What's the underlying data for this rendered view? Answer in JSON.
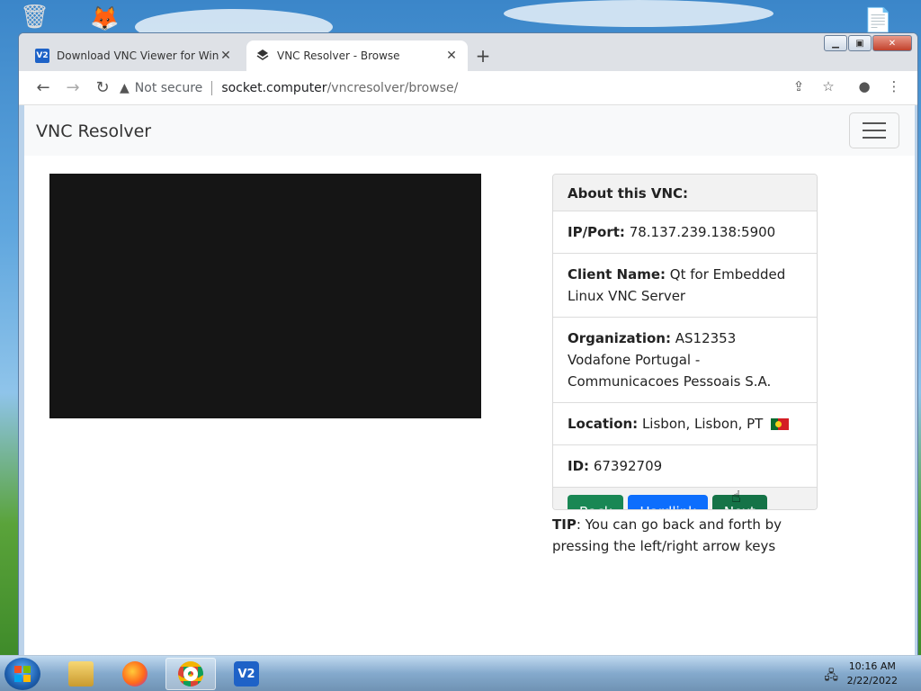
{
  "browser": {
    "tabs": [
      {
        "title": "Download VNC Viewer for Windows",
        "active": false,
        "favicon": "vnc-icon"
      },
      {
        "title": "VNC Resolver - Browse",
        "active": true,
        "favicon": "vnc-resolver-icon"
      }
    ],
    "new_tab_icon": "+",
    "address": {
      "security_label": "Not secure",
      "host": "socket.computer",
      "path": "/vncresolver/browse/"
    }
  },
  "page": {
    "brand": "VNC Resolver",
    "card": {
      "header": "About this VNC:",
      "rows": [
        {
          "label": "IP/Port:",
          "value": "78.137.239.138:5900"
        },
        {
          "label": "Client Name:",
          "value": "Qt for Embedded Linux VNC Server"
        },
        {
          "label": "Organization:",
          "value": "AS12353 Vodafone Portugal - Communicacoes Pessoais S.A."
        },
        {
          "label": "Location:",
          "value": "Lisbon, Lisbon, PT"
        },
        {
          "label": "ID:",
          "value": "67392709"
        }
      ],
      "buttons": {
        "back": "Back",
        "hardlink": "Hardlink",
        "next": "Next"
      }
    },
    "tip": {
      "label": "TIP",
      "text": ": You can go back and forth by pressing the left/right arrow keys"
    }
  },
  "taskbar": {
    "apps": [
      "explorer-icon",
      "firefox-icon",
      "chrome-icon",
      "vnc-viewer-icon"
    ],
    "time": "10:16 AM",
    "date": "2/22/2022"
  },
  "colors": {
    "btn_green": "#198754",
    "btn_blue": "#0d6efd",
    "screen_bg": "#151515"
  }
}
